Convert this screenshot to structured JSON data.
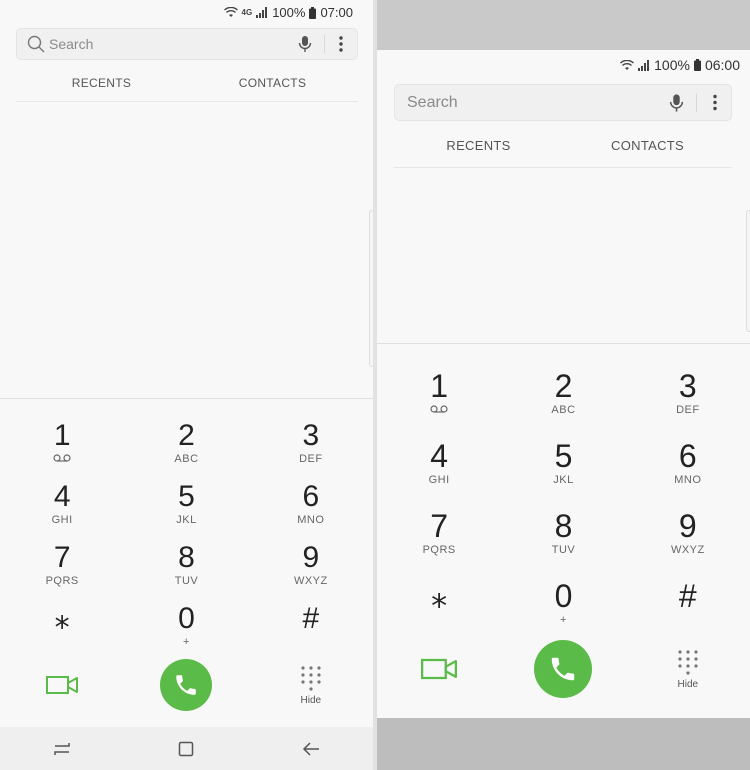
{
  "left_phone": {
    "status": {
      "network": "4G",
      "battery": "100%",
      "time": "07:00"
    },
    "search": {
      "placeholder": "Search"
    },
    "tabs": [
      "RECENTS",
      "CONTACTS"
    ],
    "keys": [
      {
        "digit": "1",
        "sub": ""
      },
      {
        "digit": "2",
        "sub": "ABC"
      },
      {
        "digit": "3",
        "sub": "DEF"
      },
      {
        "digit": "4",
        "sub": "GHI"
      },
      {
        "digit": "5",
        "sub": "JKL"
      },
      {
        "digit": "6",
        "sub": "MNO"
      },
      {
        "digit": "7",
        "sub": "PQRS"
      },
      {
        "digit": "8",
        "sub": "TUV"
      },
      {
        "digit": "9",
        "sub": "WXYZ"
      },
      {
        "digit": "⁎",
        "sub": ""
      },
      {
        "digit": "0",
        "sub": "+"
      },
      {
        "digit": "#",
        "sub": ""
      }
    ],
    "hide_label": "Hide"
  },
  "right_phone": {
    "status": {
      "battery": "100%",
      "time": "06:00"
    },
    "search": {
      "placeholder": "Search"
    },
    "tabs": [
      "RECENTS",
      "CONTACTS"
    ],
    "keys": [
      {
        "digit": "1",
        "sub": ""
      },
      {
        "digit": "2",
        "sub": "ABC"
      },
      {
        "digit": "3",
        "sub": "DEF"
      },
      {
        "digit": "4",
        "sub": "GHI"
      },
      {
        "digit": "5",
        "sub": "JKL"
      },
      {
        "digit": "6",
        "sub": "MNO"
      },
      {
        "digit": "7",
        "sub": "PQRS"
      },
      {
        "digit": "8",
        "sub": "TUV"
      },
      {
        "digit": "9",
        "sub": "WXYZ"
      },
      {
        "digit": "⁎",
        "sub": ""
      },
      {
        "digit": "0",
        "sub": "+"
      },
      {
        "digit": "#",
        "sub": ""
      }
    ],
    "hide_label": "Hide"
  },
  "icons": {
    "status": [
      "wifi-icon",
      "signal-icon",
      "battery-icon"
    ],
    "search": [
      "magnifier-icon",
      "microphone-icon",
      "more-options-icon"
    ],
    "keypad": [
      "voicemail-icon"
    ],
    "actions": [
      "video-call-icon",
      "phone-icon",
      "keypad-hide-icon"
    ],
    "navigation": [
      "recent-apps-icon",
      "home-icon",
      "back-icon"
    ]
  },
  "colors": {
    "call_green": "#5bbb48",
    "background": "#f8f8f8"
  }
}
